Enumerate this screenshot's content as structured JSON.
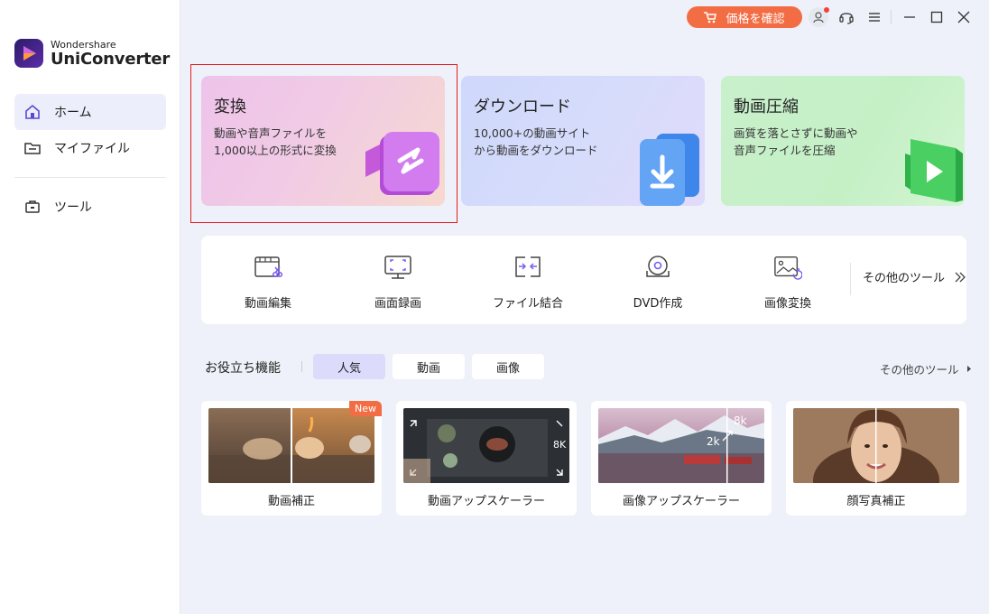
{
  "app": {
    "brand_small": "Wondershare",
    "brand_name": "UniConverter"
  },
  "sidebar": {
    "items": [
      {
        "label": "ホーム",
        "icon": "home-icon",
        "active": true
      },
      {
        "label": "マイファイル",
        "icon": "folder-icon",
        "active": false
      },
      {
        "label": "ツール",
        "icon": "toolbox-icon",
        "active": false
      }
    ]
  },
  "titlebar": {
    "price_label": "価格を確認",
    "icons": [
      "user-icon",
      "headset-icon",
      "menu-icon",
      "minimize-icon",
      "maximize-icon",
      "close-icon"
    ]
  },
  "hero_cards": [
    {
      "title": "変換",
      "desc": "動画や音声ファイルを1,000以上の形式に変換",
      "selected": true
    },
    {
      "title": "ダウンロード",
      "desc": "10,000+の動画サイトから動画をダウンロード",
      "selected": false
    },
    {
      "title": "動画圧縮",
      "desc": "画質を落とさずに動画や音声ファイルを圧縮",
      "selected": false
    }
  ],
  "tools": {
    "items": [
      {
        "label": "動画編集",
        "icon": "video-edit-icon"
      },
      {
        "label": "画面録画",
        "icon": "screen-record-icon"
      },
      {
        "label": "ファイル結合",
        "icon": "merge-icon"
      },
      {
        "label": "DVD作成",
        "icon": "dvd-icon"
      },
      {
        "label": "画像変換",
        "icon": "image-convert-icon"
      }
    ],
    "more_label": "その他のツール"
  },
  "features": {
    "section_title": "お役立ち機能",
    "tabs": [
      {
        "label": "人気",
        "active": true
      },
      {
        "label": "動画",
        "active": false
      },
      {
        "label": "画像",
        "active": false
      }
    ],
    "more_label": "その他のツール",
    "cards": [
      {
        "label": "動画補正",
        "badge": "New"
      },
      {
        "label": "動画アップスケーラー",
        "badge": "",
        "overlay": "8K"
      },
      {
        "label": "画像アップスケーラー",
        "badge": "",
        "overlay_a": "8k",
        "overlay_b": "2k"
      },
      {
        "label": "顔写真補正",
        "badge": ""
      }
    ]
  },
  "colors": {
    "accent": "#f36d44",
    "brand": "#5b2ca8",
    "chip_active": "#dcdbfb",
    "selection": "#e21d1d"
  }
}
